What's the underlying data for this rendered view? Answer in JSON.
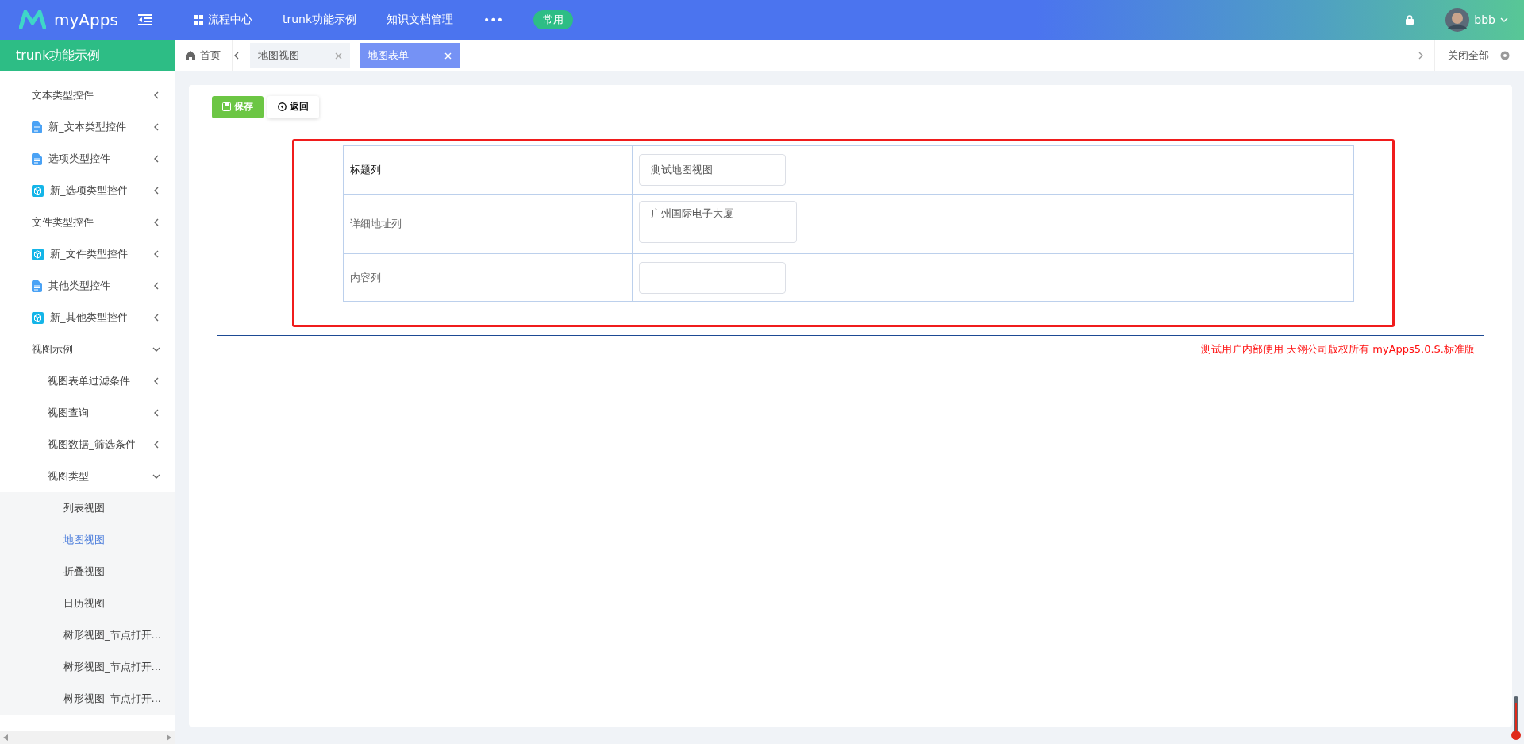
{
  "header": {
    "logo": "myApps",
    "nav": [
      {
        "label": "流程中心",
        "kind": "grid"
      },
      {
        "label": "trunk功能示例",
        "kind": "plain"
      },
      {
        "label": "知识文档管理",
        "kind": "plain"
      },
      {
        "label": "•••",
        "kind": "plain"
      }
    ],
    "badge": "常用",
    "user": "bbb"
  },
  "sidebar": {
    "title": "trunk功能示例",
    "items": [
      {
        "label": "文本类型控件",
        "kind": "plain",
        "expanded": false
      },
      {
        "label": "新_文本类型控件",
        "kind": "document",
        "expanded": false
      },
      {
        "label": "选项类型控件",
        "kind": "document",
        "expanded": false
      },
      {
        "label": "新_选项类型控件",
        "kind": "module",
        "expanded": false
      },
      {
        "label": "文件类型控件",
        "kind": "plain",
        "expanded": false
      },
      {
        "label": "新_文件类型控件",
        "kind": "module",
        "expanded": false
      },
      {
        "label": "其他类型控件",
        "kind": "document",
        "expanded": false
      },
      {
        "label": "新_其他类型控件",
        "kind": "module",
        "expanded": false
      },
      {
        "label": "视图示例",
        "kind": "plain",
        "expanded": true,
        "children": [
          {
            "label": "视图表单过滤条件",
            "kind": "plain",
            "expanded": false
          },
          {
            "label": "视图查询",
            "kind": "plain",
            "expanded": false
          },
          {
            "label": "视图数据_筛选条件",
            "kind": "plain",
            "expanded": false
          },
          {
            "label": "视图类型",
            "kind": "plain",
            "expanded": true,
            "children": [
              {
                "label": "列表视图",
                "selected": false
              },
              {
                "label": "地图视图",
                "selected": true
              },
              {
                "label": "折叠视图",
                "selected": false
              },
              {
                "label": "日历视图",
                "selected": false
              },
              {
                "label": "树形视图_节点打开...",
                "selected": false
              },
              {
                "label": "树形视图_节点打开...",
                "selected": false
              },
              {
                "label": "树形视图_节点打开...",
                "selected": false
              }
            ]
          }
        ]
      }
    ]
  },
  "tabbar": {
    "home": "首页",
    "tabs": [
      {
        "label": "地图视图",
        "selected": false
      },
      {
        "label": "地图表单",
        "selected": true
      }
    ],
    "close_all": "关闭全部"
  },
  "toolbar": {
    "buttons": [
      {
        "label": "保存",
        "kind": "save"
      },
      {
        "label": "返回",
        "kind": "back"
      }
    ]
  },
  "form": {
    "rows": [
      {
        "label": "标题列",
        "emphasized": true,
        "kind": "input",
        "value": "测试地图视图"
      },
      {
        "label": "详细地址列",
        "emphasized": false,
        "kind": "textarea",
        "value": "广州国际电子大厦"
      },
      {
        "label": "内容列",
        "emphasized": false,
        "kind": "input"
      }
    ]
  },
  "footer": "测试用户内部使用 天翎公司版权所有 myApps5.0.S.标准版"
}
